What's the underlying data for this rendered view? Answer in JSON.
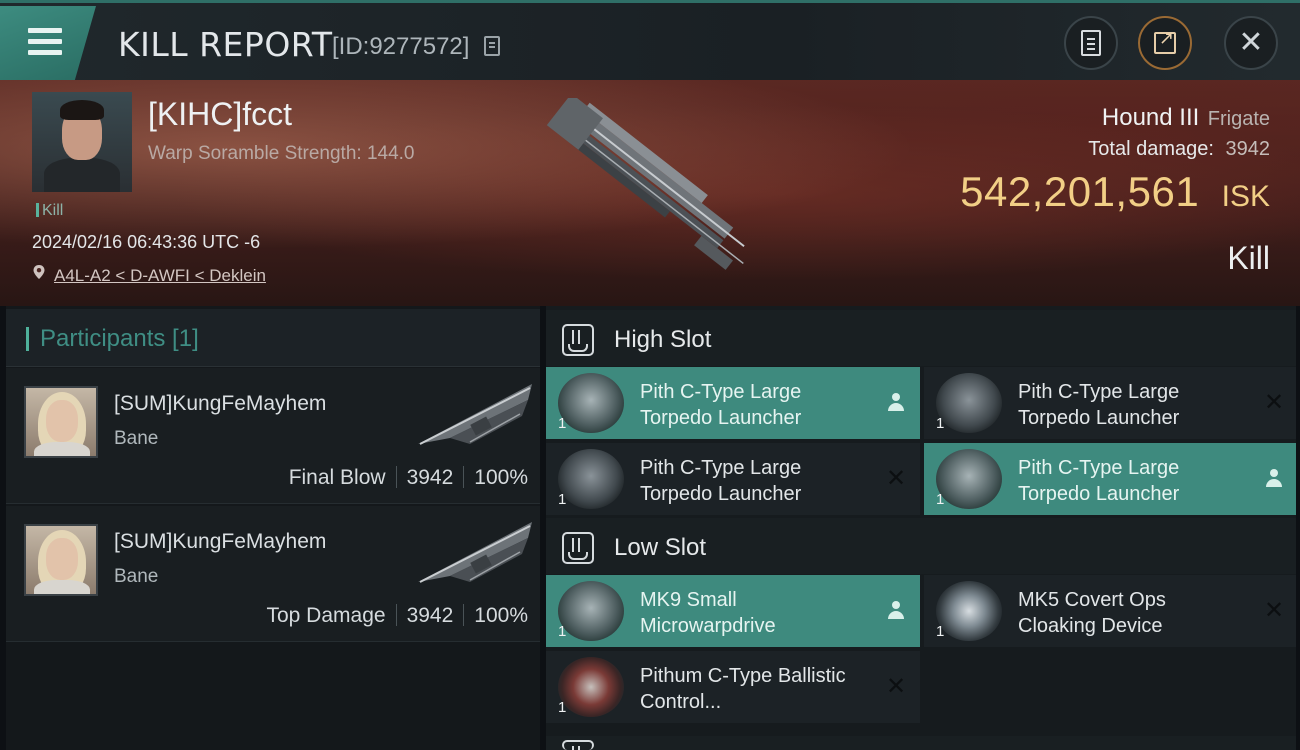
{
  "header": {
    "title": "KILL REPORT",
    "report_id": "[ID:9277572]"
  },
  "victim": {
    "name": "[KIHC]fcct",
    "warp_scramble": "Warp Soramble Strength: 144.0",
    "tag": "Kill",
    "datetime": "2024/02/16 06:43:36 UTC -6",
    "location": "A4L-A2 < D-AWFI < Deklein",
    "ship_name": "Hound III",
    "ship_class": "Frigate",
    "total_damage_label": "Total damage:",
    "total_damage": "3942",
    "isk_value": "542,201,561",
    "isk_unit": "ISK",
    "result": "Kill"
  },
  "participants": {
    "title": "Participants [1]",
    "list": [
      {
        "name": "[SUM]KungFeMayhem",
        "ship": "Bane",
        "role": "Final Blow",
        "damage": "3942",
        "percent": "100%"
      },
      {
        "name": "[SUM]KungFeMayhem",
        "ship": "Bane",
        "role": "Top Damage",
        "damage": "3942",
        "percent": "100%"
      }
    ]
  },
  "slots": {
    "high": {
      "title": "High Slot",
      "modules": [
        {
          "name": "Pith C-Type Large Torpedo Launcher",
          "qty": "1",
          "status": "dropped"
        },
        {
          "name": "Pith C-Type Large Torpedo Launcher",
          "qty": "1",
          "status": "destroyed"
        },
        {
          "name": "Pith C-Type Large Torpedo Launcher",
          "qty": "1",
          "status": "destroyed"
        },
        {
          "name": "Pith C-Type Large Torpedo Launcher",
          "qty": "1",
          "status": "dropped"
        }
      ]
    },
    "low": {
      "title": "Low Slot",
      "modules": [
        {
          "name": "MK9 Small Microwarpdrive",
          "qty": "1",
          "status": "dropped"
        },
        {
          "name": "MK5 Covert Ops Cloaking Device",
          "qty": "1",
          "status": "destroyed"
        },
        {
          "name": "Pithum C-Type Ballistic Control...",
          "qty": "1",
          "status": "destroyed"
        }
      ]
    }
  },
  "colors": {
    "accent": "#3e8a7e",
    "isk": "#f2cf86",
    "header_bg": "#1a2024"
  },
  "icons": {
    "menu": "hamburger-icon",
    "copy": "copy-icon",
    "fitting": "clipboard-icon",
    "share": "share-icon",
    "close": "close-icon",
    "location": "location-pin-icon",
    "slot": "slot-icon",
    "dropped": "person-icon",
    "destroyed": "close-icon"
  }
}
